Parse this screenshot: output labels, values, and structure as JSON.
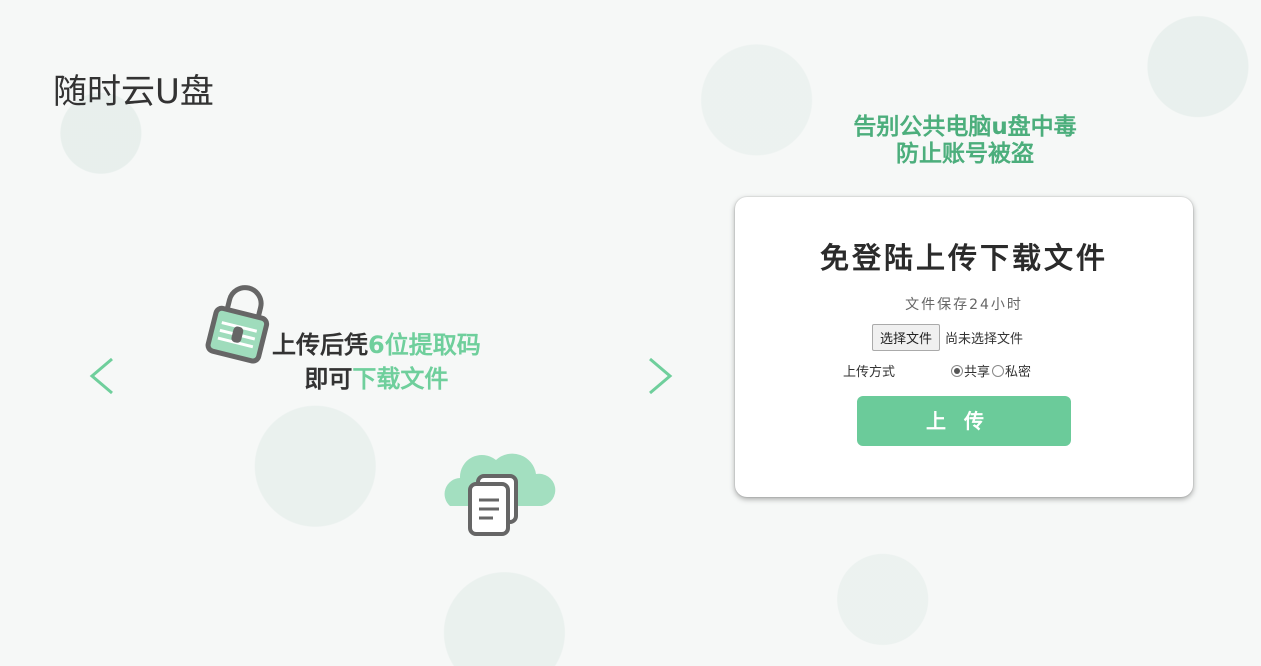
{
  "site_title": "随时云U盘",
  "slide": {
    "line1_prefix": "上传后凭",
    "line1_accent": "6位提取码",
    "line2_prefix": "即可",
    "line2_accent": "下载文件"
  },
  "promo": {
    "line1": "告别公共电脑u盘中毒",
    "line2": "防止账号被盗"
  },
  "card": {
    "title": "免登陆上传下载文件",
    "note": "文件保存24小时",
    "file_button": "选择文件",
    "file_status": "尚未选择文件",
    "mode_label": "上传方式",
    "option_share": "共享",
    "option_private": "私密",
    "selected_option": "共享",
    "upload_button": "上传"
  },
  "colors": {
    "accent": "#6bcb9a",
    "promo_green": "#4cae7c"
  },
  "icons": [
    "chevron-left-icon",
    "chevron-right-icon",
    "padlock-icon",
    "cloud-files-icon"
  ]
}
